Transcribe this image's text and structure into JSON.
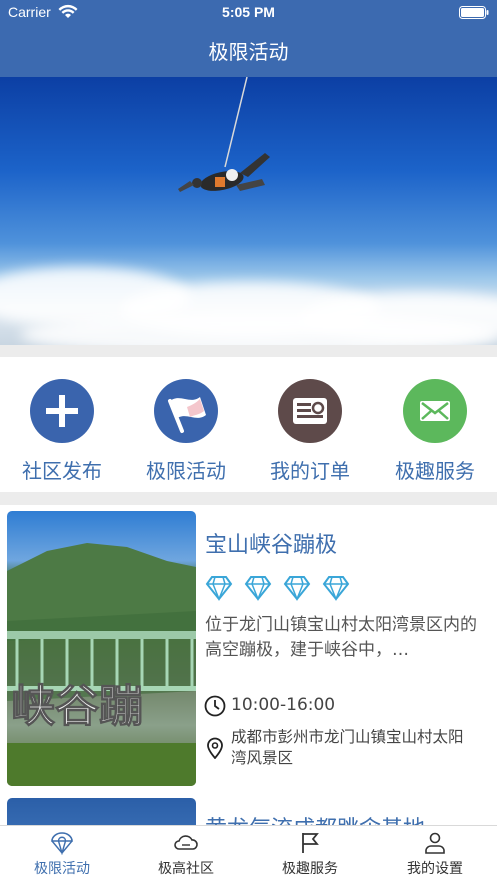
{
  "status_bar": {
    "carrier": "Carrier",
    "time": "5:05 PM"
  },
  "nav": {
    "title": "极限活动"
  },
  "categories": [
    {
      "label": "社区发布",
      "icon": "plus-icon",
      "color": "#3a64ad"
    },
    {
      "label": "极限活动",
      "icon": "flag-icon",
      "color": "#3a64ad"
    },
    {
      "label": "我的订单",
      "icon": "order-card-icon",
      "color": "#5e4a4a"
    },
    {
      "label": "极趣服务",
      "icon": "mail-icon",
      "color": "#5cb85c"
    }
  ],
  "items": [
    {
      "title": "宝山峡谷蹦极",
      "thumb_text": "峡谷蹦",
      "rating_icon": "diamond-icon",
      "rating": 4,
      "description": "位于龙门山镇宝山村太阳湾景区内的高空蹦极，建于峡谷中，…",
      "hours": "10:00-16:00",
      "address": "成都市彭州市龙门山镇宝山村太阳湾风景区"
    },
    {
      "title": "黄龙气流成都跳伞基地"
    }
  ],
  "tabs": [
    {
      "label": "极限活动",
      "icon": "parachute-icon",
      "active": true
    },
    {
      "label": "极高社区",
      "icon": "cloud-icon",
      "active": false
    },
    {
      "label": "极趣服务",
      "icon": "flag-outline-icon",
      "active": false
    },
    {
      "label": "我的设置",
      "icon": "person-icon",
      "active": false
    }
  ],
  "colors": {
    "primary": "#3c6ab0",
    "accent_text": "#3f6fae",
    "separator": "#ececec"
  }
}
